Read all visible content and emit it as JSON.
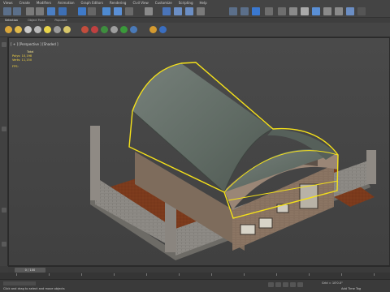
{
  "menubar": {
    "items": [
      "Views",
      "Create",
      "Modifiers",
      "Animation",
      "Graph Editors",
      "Rendering",
      "Civil View",
      "Customize",
      "Scripting",
      "Help"
    ]
  },
  "ribbon": {
    "tabs": [
      "Selection",
      "Object Paint",
      "Populate"
    ]
  },
  "viewport": {
    "label": "[ + ] [Perspective ] [Shaded ]",
    "stats": {
      "header": "Total",
      "polys_label": "Polys:",
      "polys_value": "10,198",
      "verts_label": "Verts:",
      "verts_value": "11,150",
      "fps_label": "FPS:"
    }
  },
  "timeline": {
    "frame_readout": "0 / 100"
  },
  "status": {
    "prompt": "Click and drag to select and move objects",
    "grid": "Grid = 10'0.0\"",
    "add_time_tag": "Add Time Tag"
  },
  "colors": {
    "selection_outline": "#f5e11a",
    "roof": "#6c776e",
    "brick": "#8b7563",
    "courtyard": "#7b3a1c",
    "viewport_bg": "#464646"
  }
}
